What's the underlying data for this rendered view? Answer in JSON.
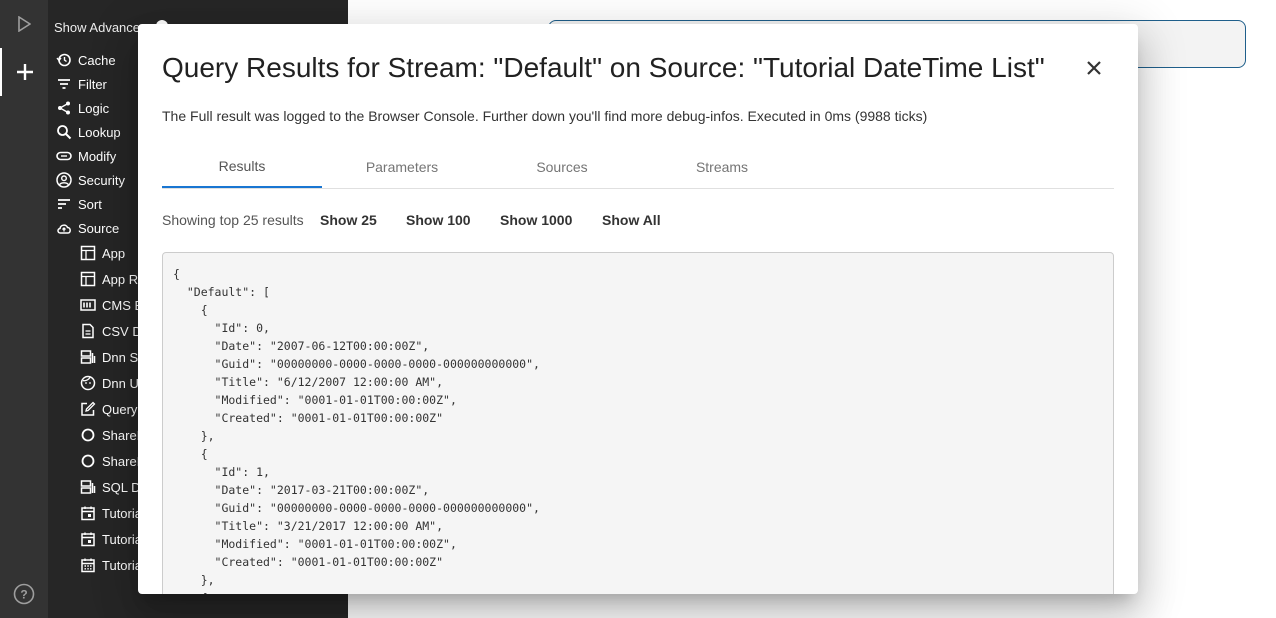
{
  "sidebar": {
    "advanced_label": "Show Advance",
    "items": [
      {
        "label": "Cache",
        "icon": "history-icon"
      },
      {
        "label": "Filter",
        "icon": "filter-icon"
      },
      {
        "label": "Logic",
        "icon": "share-icon"
      },
      {
        "label": "Lookup",
        "icon": "search-icon"
      },
      {
        "label": "Modify",
        "icon": "pill-icon"
      },
      {
        "label": "Security",
        "icon": "account-circle-icon"
      },
      {
        "label": "Sort",
        "icon": "sort-icon"
      },
      {
        "label": "Source",
        "icon": "cloud-upload-icon"
      }
    ],
    "sources": [
      {
        "label": "App",
        "icon": "table-icon"
      },
      {
        "label": "App Ro",
        "icon": "table-icon"
      },
      {
        "label": "CMS B",
        "icon": "view-list-icon"
      },
      {
        "label": "CSV Da",
        "icon": "file-icon"
      },
      {
        "label": "Dnn SQ",
        "icon": "database-icon"
      },
      {
        "label": "Dnn Us",
        "icon": "face-icon"
      },
      {
        "label": "Query",
        "icon": "edit-icon"
      },
      {
        "label": "ShareP",
        "icon": "circle-icon"
      },
      {
        "label": "ShareP",
        "icon": "circle-icon"
      },
      {
        "label": "SQL Da",
        "icon": "database-icon"
      },
      {
        "label": "Tutoria",
        "icon": "calendar-icon"
      },
      {
        "label": "Tutoria",
        "icon": "calendar-icon"
      },
      {
        "label": "Tutoria",
        "icon": "calendar-month-icon"
      }
    ]
  },
  "dialog": {
    "title": "Query Results for Stream: \"Default\" on Source: \"Tutorial DateTime List\"",
    "description": "The Full result was logged to the Browser Console. Further down you'll find more debug-infos. Executed in 0ms (9988 ticks)",
    "tabs": [
      "Results",
      "Parameters",
      "Sources",
      "Streams"
    ],
    "active_tab": "Results",
    "showing_label": "Showing top 25 results",
    "show_buttons": [
      "Show 25",
      "Show 100",
      "Show 1000",
      "Show All"
    ],
    "json_text": "{\n  \"Default\": [\n    {\n      \"Id\": 0,\n      \"Date\": \"2007-06-12T00:00:00Z\",\n      \"Guid\": \"00000000-0000-0000-0000-000000000000\",\n      \"Title\": \"6/12/2007 12:00:00 AM\",\n      \"Modified\": \"0001-01-01T00:00:00Z\",\n      \"Created\": \"0001-01-01T00:00:00Z\"\n    },\n    {\n      \"Id\": 1,\n      \"Date\": \"2017-03-21T00:00:00Z\",\n      \"Guid\": \"00000000-0000-0000-0000-000000000000\",\n      \"Title\": \"3/21/2017 12:00:00 AM\",\n      \"Modified\": \"0001-01-01T00:00:00Z\",\n      \"Created\": \"0001-01-01T00:00:00Z\"\n    },\n    {"
  },
  "colors": {
    "accent": "#1976d2",
    "sidebar_bg": "#262626",
    "rail_bg": "#333333"
  }
}
